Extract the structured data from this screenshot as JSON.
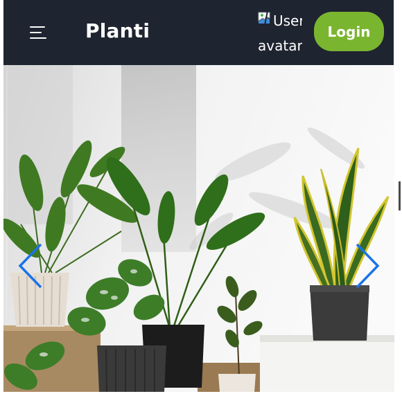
{
  "navbar": {
    "brand": "Planti",
    "avatar_alt_line1": "User",
    "avatar_alt_line2": "avatar",
    "login_label": "Login",
    "background": "#1e2430",
    "login_color": "#7ab52f"
  },
  "hero": {
    "image": "Potted house plants against a white wall",
    "prev_icon": "chevron-left-icon",
    "next_icon": "chevron-right-icon",
    "arrow_color": "#1a73e8"
  }
}
